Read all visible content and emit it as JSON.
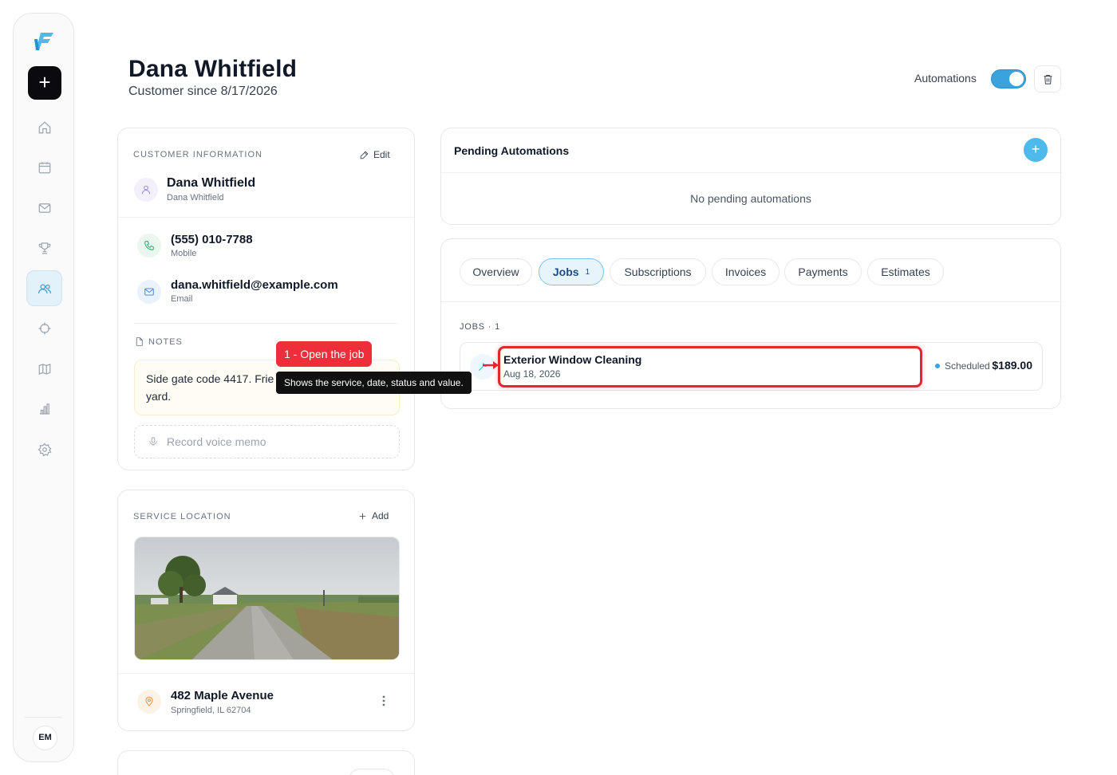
{
  "sidebar": {
    "new_label": "+",
    "avatar_initials": "EM",
    "items": [
      {
        "name": "home-icon"
      },
      {
        "name": "calendar-icon"
      },
      {
        "name": "mail-icon"
      },
      {
        "name": "trophy-icon"
      },
      {
        "name": "users-icon",
        "active": true
      },
      {
        "name": "crosshair-icon"
      },
      {
        "name": "map-icon"
      },
      {
        "name": "bar-chart-icon"
      },
      {
        "name": "gear-icon"
      }
    ]
  },
  "header": {
    "title": "Dana Whitfield",
    "subtitle": "Customer since 8/17/2026",
    "automations_label": "Automations",
    "automations_on": true
  },
  "customer_info": {
    "section_label": "CUSTOMER INFORMATION",
    "edit_label": "Edit",
    "name": "Dana Whitfield",
    "name_sub": "Dana Whitfield",
    "phone": "(555) 010-7788",
    "phone_label": "Mobile",
    "email": "dana.whitfield@example.com",
    "email_label": "Email",
    "notes_label": "NOTES",
    "notes_text_start": "Side gate code 4417. Frie",
    "notes_text_end": "yard.",
    "memo_label": "Record voice memo"
  },
  "service_location": {
    "section_label": "SERVICE LOCATION",
    "add_label": "Add",
    "address": "482 Maple Avenue",
    "city": "Springfield, IL 62704"
  },
  "pending_automations": {
    "title": "Pending Automations",
    "add_label": "+",
    "empty_text": "No pending automations"
  },
  "tabs": [
    {
      "label": "Overview"
    },
    {
      "label": "Jobs",
      "count": "1",
      "active": true
    },
    {
      "label": "Subscriptions"
    },
    {
      "label": "Invoices"
    },
    {
      "label": "Payments"
    },
    {
      "label": "Estimates"
    }
  ],
  "jobs": {
    "label": "JOBS · 1",
    "items": [
      {
        "title": "Exterior Window Cleaning",
        "date": "Aug 18, 2026",
        "status": "Scheduled",
        "amount": "$189.00"
      }
    ]
  },
  "tour": {
    "badge": "1 - Open the job",
    "tooltip": "Shows the service, date, status and value."
  },
  "colors": {
    "accent": "#3aa3dd",
    "highlight": "#e5262d",
    "badge": "#ee2f3b"
  }
}
